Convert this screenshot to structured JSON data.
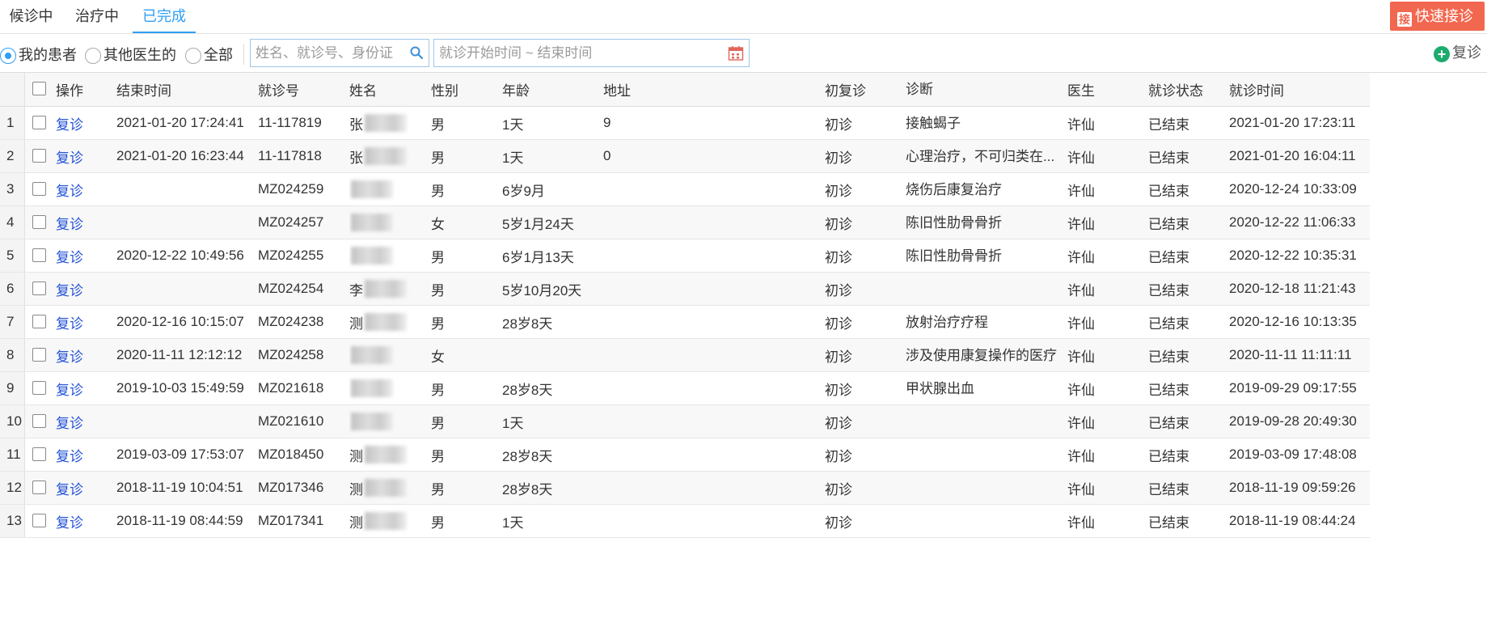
{
  "tabs": [
    {
      "label": "候诊中",
      "active": false
    },
    {
      "label": "治疗中",
      "active": false
    },
    {
      "label": "已完成",
      "active": true
    }
  ],
  "quick_button": {
    "label": "快速接诊",
    "icon": "quick-reception-icon",
    "color": "#f2674f"
  },
  "filters": {
    "radios": [
      {
        "label": "我的患者",
        "checked": true
      },
      {
        "label": "其他医生的",
        "checked": false
      },
      {
        "label": "全部",
        "checked": false
      }
    ],
    "search_placeholder": "姓名、就诊号、身份证",
    "date_placeholder": "就诊开始时间 ~ 结束时间"
  },
  "revisit_button": {
    "label": "复诊",
    "icon": "plus-circle-icon"
  },
  "table": {
    "columns": [
      "操作",
      "结束时间",
      "就诊号",
      "姓名",
      "性别",
      "年龄",
      "地址",
      "初复诊",
      "诊断",
      "医生",
      "就诊状态",
      "就诊时间"
    ],
    "rows": [
      {
        "num": "1",
        "action": "复诊",
        "end_time": "2021-01-20 17:24:41",
        "visit_no": "11-117819",
        "name": "张",
        "sex": "男",
        "age": "1天",
        "address": "9",
        "visit_type": "初诊",
        "diagnosis": "接触蝎子",
        "doctor": "许仙",
        "status": "已结束",
        "visit_time": "2021-01-20 17:23:11"
      },
      {
        "num": "2",
        "action": "复诊",
        "end_time": "2021-01-20 16:23:44",
        "visit_no": "11-117818",
        "name": "张",
        "sex": "男",
        "age": "1天",
        "address": "0",
        "visit_type": "初诊",
        "diagnosis": "心理治疗，不可归类在...",
        "doctor": "许仙",
        "status": "已结束",
        "visit_time": "2021-01-20 16:04:11"
      },
      {
        "num": "3",
        "action": "复诊",
        "end_time": "",
        "visit_no": "MZ024259",
        "name": "",
        "sex": "男",
        "age": "6岁9月",
        "address": "",
        "visit_type": "初诊",
        "diagnosis": "烧伤后康复治疗",
        "doctor": "许仙",
        "status": "已结束",
        "visit_time": "2020-12-24 10:33:09"
      },
      {
        "num": "4",
        "action": "复诊",
        "end_time": "",
        "visit_no": "MZ024257",
        "name": "",
        "sex": "女",
        "age": "5岁1月24天",
        "address": "",
        "visit_type": "初诊",
        "diagnosis": "陈旧性肋骨骨折",
        "doctor": "许仙",
        "status": "已结束",
        "visit_time": "2020-12-22 11:06:33"
      },
      {
        "num": "5",
        "action": "复诊",
        "end_time": "2020-12-22 10:49:56",
        "visit_no": "MZ024255",
        "name": "",
        "sex": "男",
        "age": "6岁1月13天",
        "address": "",
        "visit_type": "初诊",
        "diagnosis": "陈旧性肋骨骨折",
        "doctor": "许仙",
        "status": "已结束",
        "visit_time": "2020-12-22 10:35:31"
      },
      {
        "num": "6",
        "action": "复诊",
        "end_time": "",
        "visit_no": "MZ024254",
        "name": "李",
        "sex": "男",
        "age": "5岁10月20天",
        "address": "",
        "visit_type": "初诊",
        "diagnosis": "",
        "doctor": "许仙",
        "status": "已结束",
        "visit_time": "2020-12-18 11:21:43"
      },
      {
        "num": "7",
        "action": "复诊",
        "end_time": "2020-12-16 10:15:07",
        "visit_no": "MZ024238",
        "name": "测",
        "sex": "男",
        "age": "28岁8天",
        "address": "",
        "visit_type": "初诊",
        "diagnosis": "放射治疗疗程",
        "doctor": "许仙",
        "status": "已结束",
        "visit_time": "2020-12-16 10:13:35"
      },
      {
        "num": "8",
        "action": "复诊",
        "end_time": "2020-11-11 12:12:12",
        "visit_no": "MZ024258",
        "name": "",
        "sex": "女",
        "age": "",
        "address": "",
        "visit_type": "初诊",
        "diagnosis": "涉及使用康复操作的医疗",
        "doctor": "许仙",
        "status": "已结束",
        "visit_time": "2020-11-11 11:11:11"
      },
      {
        "num": "9",
        "action": "复诊",
        "end_time": "2019-10-03 15:49:59",
        "visit_no": "MZ021618",
        "name": "",
        "sex": "男",
        "age": "28岁8天",
        "address": "",
        "visit_type": "初诊",
        "diagnosis": "甲状腺出血",
        "doctor": "许仙",
        "status": "已结束",
        "visit_time": "2019-09-29 09:17:55"
      },
      {
        "num": "10",
        "action": "复诊",
        "end_time": "",
        "visit_no": "MZ021610",
        "name": "",
        "sex": "男",
        "age": "1天",
        "address": "",
        "visit_type": "初诊",
        "diagnosis": "",
        "doctor": "许仙",
        "status": "已结束",
        "visit_time": "2019-09-28 20:49:30"
      },
      {
        "num": "11",
        "action": "复诊",
        "end_time": "2019-03-09 17:53:07",
        "visit_no": "MZ018450",
        "name": "测",
        "sex": "男",
        "age": "28岁8天",
        "address": "",
        "visit_type": "初诊",
        "diagnosis": "",
        "doctor": "许仙",
        "status": "已结束",
        "visit_time": "2019-03-09 17:48:08"
      },
      {
        "num": "12",
        "action": "复诊",
        "end_time": "2018-11-19 10:04:51",
        "visit_no": "MZ017346",
        "name": "测",
        "sex": "男",
        "age": "28岁8天",
        "address": "",
        "visit_type": "初诊",
        "diagnosis": "",
        "doctor": "许仙",
        "status": "已结束",
        "visit_time": "2018-11-19 09:59:26"
      },
      {
        "num": "13",
        "action": "复诊",
        "end_time": "2018-11-19 08:44:59",
        "visit_no": "MZ017341",
        "name": "测",
        "sex": "男",
        "age": "1天",
        "address": "",
        "visit_type": "初诊",
        "diagnosis": "",
        "doctor": "许仙",
        "status": "已结束",
        "visit_time": "2018-11-19 08:44:24"
      }
    ]
  }
}
